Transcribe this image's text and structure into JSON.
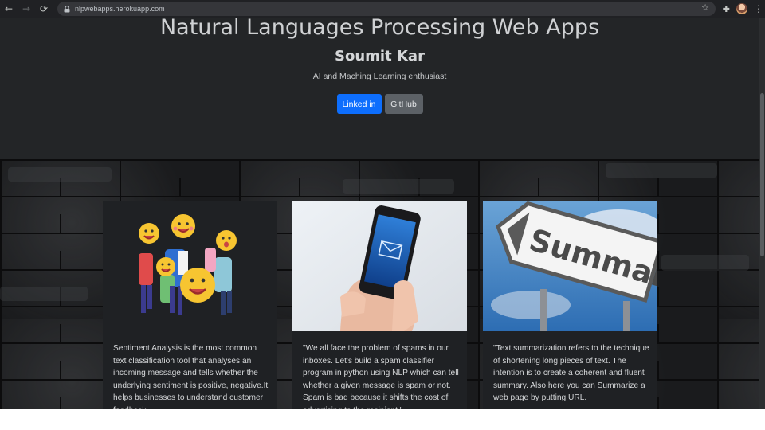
{
  "browser": {
    "url": "nlpwebapps.herokuapp.com",
    "back_icon": "←",
    "forward_icon": "→",
    "reload_icon": "⟳",
    "star_icon": "☆",
    "extension_icon": "✚",
    "menu_icon": "⋮"
  },
  "hero": {
    "title": "Natural Languages Processing Web Apps",
    "name": "Soumit Kar",
    "tagline": "AI and Maching Learning enthusiast",
    "buttons": {
      "linkedin": "Linked in",
      "github": "GitHub"
    }
  },
  "cards": [
    {
      "image": "emoji-characters-illustration",
      "text": "Sentiment Analysis is the most common text classification tool that analyses an incoming message and tells whether the underlying sentiment is positive, negative.It helps businesses to understand customer feedback."
    },
    {
      "image": "hand-holding-phone-with-message",
      "text": "\"We all face the problem of spams in our inboxes. Let's build a spam classifier program in python using NLP which can tell whether a given message is spam or not. Spam is bad because it shifts the cost of advertising to the recipient.\""
    },
    {
      "image": "summary-road-sign",
      "text": "\"Text summarization refers to the technique of shortening long pieces of text. The intention is to create a coherent and fluent summary. Also here you can Summarize a web page by putting URL.",
      "sign_text": "Summary"
    }
  ],
  "colors": {
    "linkedin_button": "#0d6efd",
    "github_button": "#5c6166",
    "page_background": "#232527"
  }
}
